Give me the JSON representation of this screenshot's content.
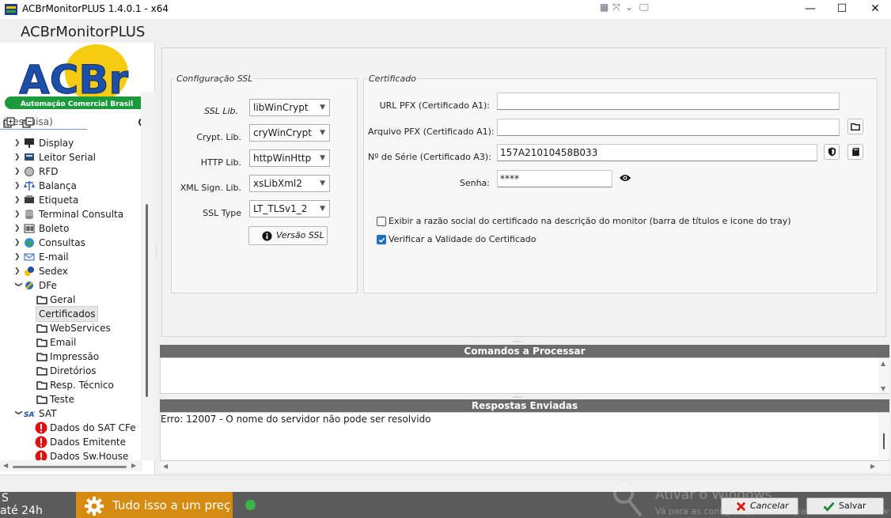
{
  "window": {
    "title": "ACBrMonitorPLUS 1.4.0.1 - x64",
    "minimize": "—",
    "maximize": "☐",
    "close": "✕"
  },
  "app": {
    "name": "ACBrMonitorPLUS"
  },
  "logo": {
    "text": "ACBr",
    "tagline": "Automação Comercial Brasil"
  },
  "search": {
    "placeholder": "(pesquisa)"
  },
  "tree": {
    "items": [
      {
        "label": "Display",
        "icon": "display-icon"
      },
      {
        "label": "Leitor Serial",
        "icon": "serial-reader-icon"
      },
      {
        "label": "RFD",
        "icon": "rfd-icon"
      },
      {
        "label": "Balança",
        "icon": "scale-icon"
      },
      {
        "label": "Etiqueta",
        "icon": "label-printer-icon"
      },
      {
        "label": "Terminal Consulta",
        "icon": "database-icon"
      },
      {
        "label": "Boleto",
        "icon": "barcode-icon"
      },
      {
        "label": "Consultas",
        "icon": "globe-icon"
      },
      {
        "label": "E-mail",
        "icon": "email-icon"
      },
      {
        "label": "Sedex",
        "icon": "sedex-icon"
      },
      {
        "label": "DFe",
        "icon": "dfe-icon"
      },
      {
        "label": "Geral",
        "icon": "folder-icon"
      },
      {
        "label": "Certificados",
        "icon": "none"
      },
      {
        "label": "WebServices",
        "icon": "folder-icon"
      },
      {
        "label": "Email",
        "icon": "folder-icon"
      },
      {
        "label": "Impressão",
        "icon": "folder-icon"
      },
      {
        "label": "Diretórios",
        "icon": "folder-icon"
      },
      {
        "label": "Resp. Técnico",
        "icon": "folder-icon"
      },
      {
        "label": "Teste",
        "icon": "folder-icon"
      },
      {
        "label": "SAT",
        "icon": "sat-icon"
      },
      {
        "label": "Dados do SAT CFe",
        "icon": "error-icon"
      },
      {
        "label": "Dados Emitente",
        "icon": "error-icon"
      },
      {
        "label": "Dados Sw.House",
        "icon": "error-icon"
      }
    ]
  },
  "ssl": {
    "legend": "Configuração SSL",
    "ssl_lib_label": "SSL Lib.",
    "ssl_lib_value": "libWinCrypt",
    "crypt_lib_label": "Crypt. Lib.",
    "crypt_lib_value": "cryWinCrypt",
    "http_lib_label": "HTTP Lib.",
    "http_lib_value": "httpWinHttp",
    "xml_lib_label": "XML Sign. Lib.",
    "xml_lib_value": "xsLibXml2",
    "ssl_type_label": "SSL Type",
    "ssl_type_value": "LT_TLSv1_2",
    "versao_label": "Versão SSL"
  },
  "cert": {
    "legend": "Certificado",
    "url_pfx_label": "URL PFX (Certificado A1):",
    "url_pfx_value": "",
    "arquivo_pfx_label": "Arquivo PFX (Certificado A1):",
    "arquivo_pfx_value": "",
    "serie_label": "Nº de Série (Certificado A3):",
    "serie_value": "157A21010458B033",
    "senha_label": "Senha:",
    "senha_value": "****",
    "exibir_label": "Exibir a razão social do certificado na descrição do monitor (barra de títulos e icone do tray)",
    "exibir_checked": false,
    "verificar_label": "Verificar a Validade do Certificado",
    "verificar_checked": true
  },
  "comandos": {
    "title": "Comandos a Processar",
    "content": ""
  },
  "respostas": {
    "title": "Respostas Enviadas",
    "content": "Erro: 12007 - O nome do servidor não pode ser resolvido"
  },
  "footer": {
    "cancel_label": "Cancelar",
    "save_label": "Salvar"
  },
  "taskbar": {
    "left_line1": "S",
    "left_line2": "até 24h",
    "notification": "Tudo isso a um preço",
    "watermark_line1": "Ativar o Windows",
    "watermark_line2": "Vá para as configurações do PC para ativar o Windows."
  },
  "colors": {
    "accent": "#1f6fc4",
    "bar": "#6b6b6b",
    "notification": "#d48b0f"
  }
}
